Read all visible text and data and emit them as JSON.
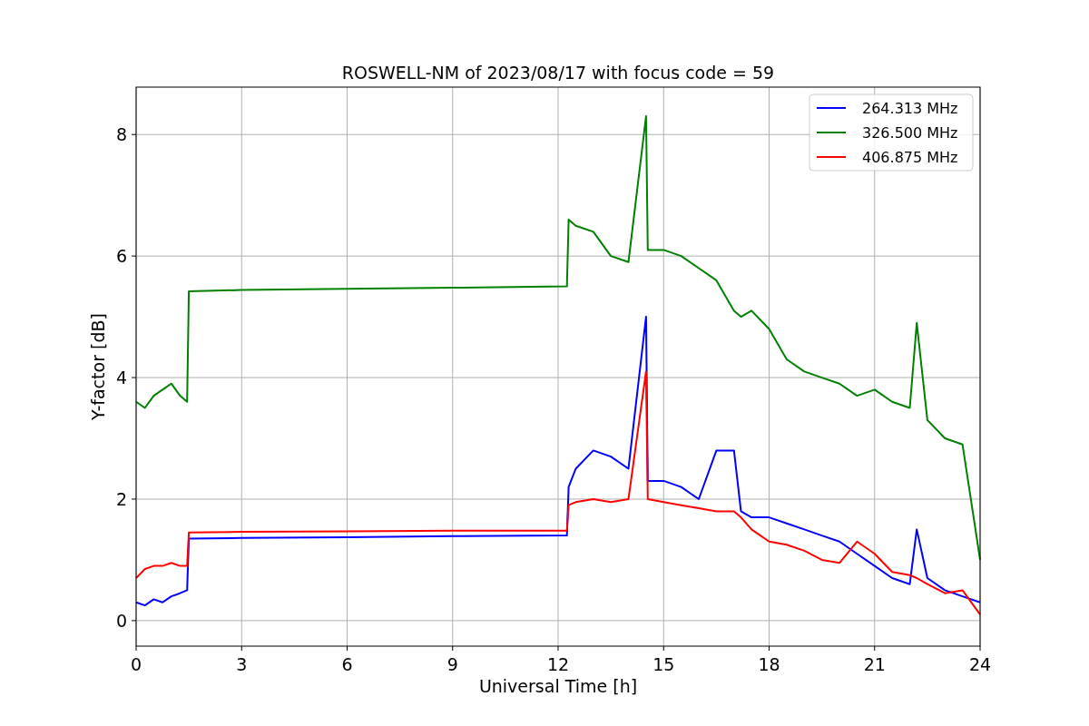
{
  "chart_data": {
    "type": "line",
    "title": "ROSWELL-NM of 2023/08/17 with focus code = 59",
    "xlabel": "Universal Time [h]",
    "ylabel": "Y-factor [dB]",
    "x": [
      0,
      0.25,
      0.5,
      0.75,
      1,
      1.25,
      1.45,
      1.5,
      3,
      6,
      9,
      12.25,
      12.3,
      12.5,
      13,
      13.5,
      14,
      14.5,
      14.55,
      15,
      15.5,
      16,
      16.5,
      17,
      17.2,
      17.5,
      18,
      18.5,
      19,
      19.5,
      20,
      20.5,
      21,
      21.5,
      22,
      22.2,
      22.5,
      23,
      23.5,
      24
    ],
    "series": [
      {
        "name": "264.313 MHz",
        "color": "#0000ff",
        "values": [
          0.3,
          0.25,
          0.35,
          0.3,
          0.4,
          0.45,
          0.5,
          1.35,
          1.36,
          1.37,
          1.39,
          1.4,
          2.2,
          2.5,
          2.8,
          2.7,
          2.5,
          5.0,
          2.3,
          2.3,
          2.2,
          2.0,
          2.8,
          2.8,
          1.8,
          1.7,
          1.7,
          1.6,
          1.5,
          1.4,
          1.3,
          1.1,
          0.9,
          0.7,
          0.6,
          1.5,
          0.7,
          0.5,
          0.4,
          0.3
        ]
      },
      {
        "name": "326.500 MHz",
        "color": "#008000",
        "values": [
          3.6,
          3.5,
          3.7,
          3.8,
          3.9,
          3.7,
          3.6,
          5.42,
          5.44,
          5.46,
          5.48,
          5.5,
          6.6,
          6.5,
          6.4,
          6.0,
          5.9,
          8.3,
          6.1,
          6.1,
          6.0,
          5.8,
          5.6,
          5.1,
          5.0,
          5.1,
          4.8,
          4.3,
          4.1,
          4.0,
          3.9,
          3.7,
          3.8,
          3.6,
          3.5,
          4.9,
          3.3,
          3.0,
          2.9,
          1.0
        ]
      },
      {
        "name": "406.875 MHz",
        "color": "#ff0000",
        "values": [
          0.7,
          0.85,
          0.9,
          0.9,
          0.95,
          0.9,
          0.9,
          1.45,
          1.46,
          1.47,
          1.48,
          1.48,
          1.9,
          1.95,
          2.0,
          1.95,
          2.0,
          4.1,
          2.0,
          1.95,
          1.9,
          1.85,
          1.8,
          1.8,
          1.7,
          1.5,
          1.3,
          1.25,
          1.15,
          1.0,
          0.95,
          1.3,
          1.1,
          0.8,
          0.75,
          0.7,
          0.6,
          0.45,
          0.5,
          0.1
        ]
      }
    ],
    "grid": true,
    "legend": true,
    "xlim": [
      0,
      24
    ],
    "ylim": [
      -0.42,
      8.78
    ],
    "xticks": [
      0,
      3,
      6,
      9,
      12,
      15,
      18,
      21,
      24
    ],
    "yticks": [
      0,
      2,
      4,
      6,
      8
    ]
  }
}
